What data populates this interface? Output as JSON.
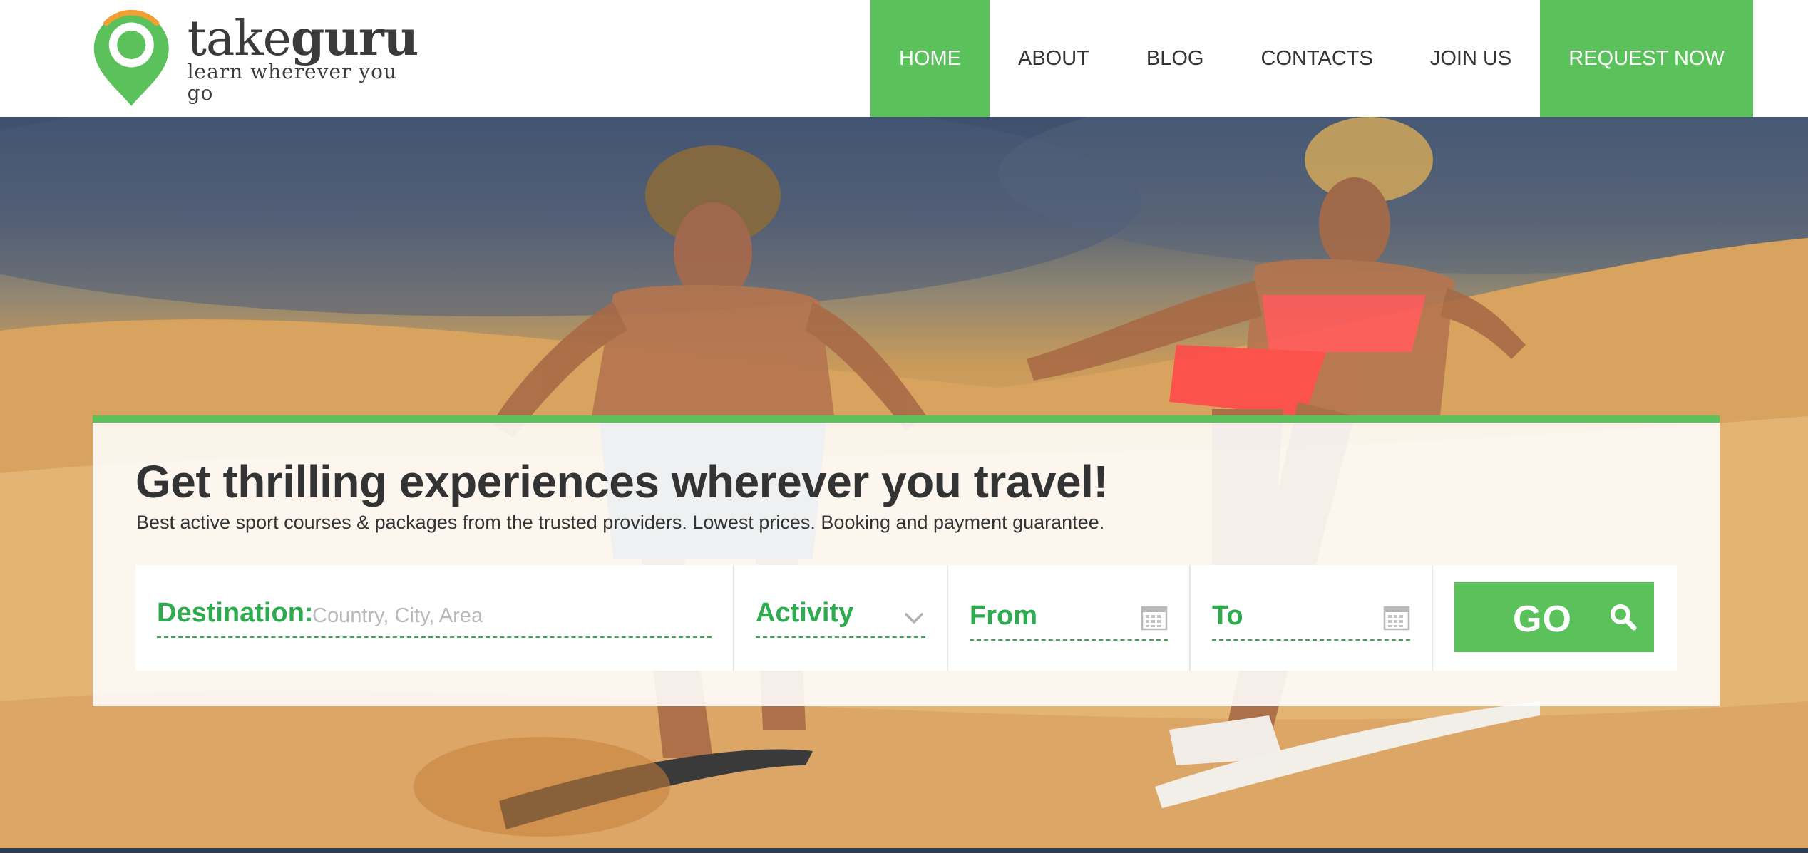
{
  "brand": {
    "name_light": "take",
    "name_bold": "guru",
    "tagline": "learn wherever you go",
    "colors": {
      "green": "#5bc15b",
      "dark_green": "#2eaa4f",
      "orange": "#f0a033",
      "text": "#333333"
    }
  },
  "nav": {
    "items": [
      {
        "label": "HOME",
        "active": true
      },
      {
        "label": "ABOUT",
        "active": false
      },
      {
        "label": "BLOG",
        "active": false
      },
      {
        "label": "CONTACTS",
        "active": false
      },
      {
        "label": "JOIN US",
        "active": false
      }
    ],
    "cta_label": "REQUEST NOW"
  },
  "hero": {
    "headline": "Get thrilling experiences wherever you travel!",
    "subheadline": "Best active sport courses & packages from the trusted providers. Lowest prices. Booking and payment guarantee."
  },
  "search": {
    "destination_label": "Destination:",
    "destination_placeholder": "Country, City, Area",
    "activity_label": "Activity",
    "from_label": "From",
    "to_label": "To",
    "go_label": "GO",
    "icons": {
      "activity": "chevron-down-icon",
      "from": "calendar-icon",
      "to": "calendar-icon",
      "go": "search-icon"
    }
  }
}
